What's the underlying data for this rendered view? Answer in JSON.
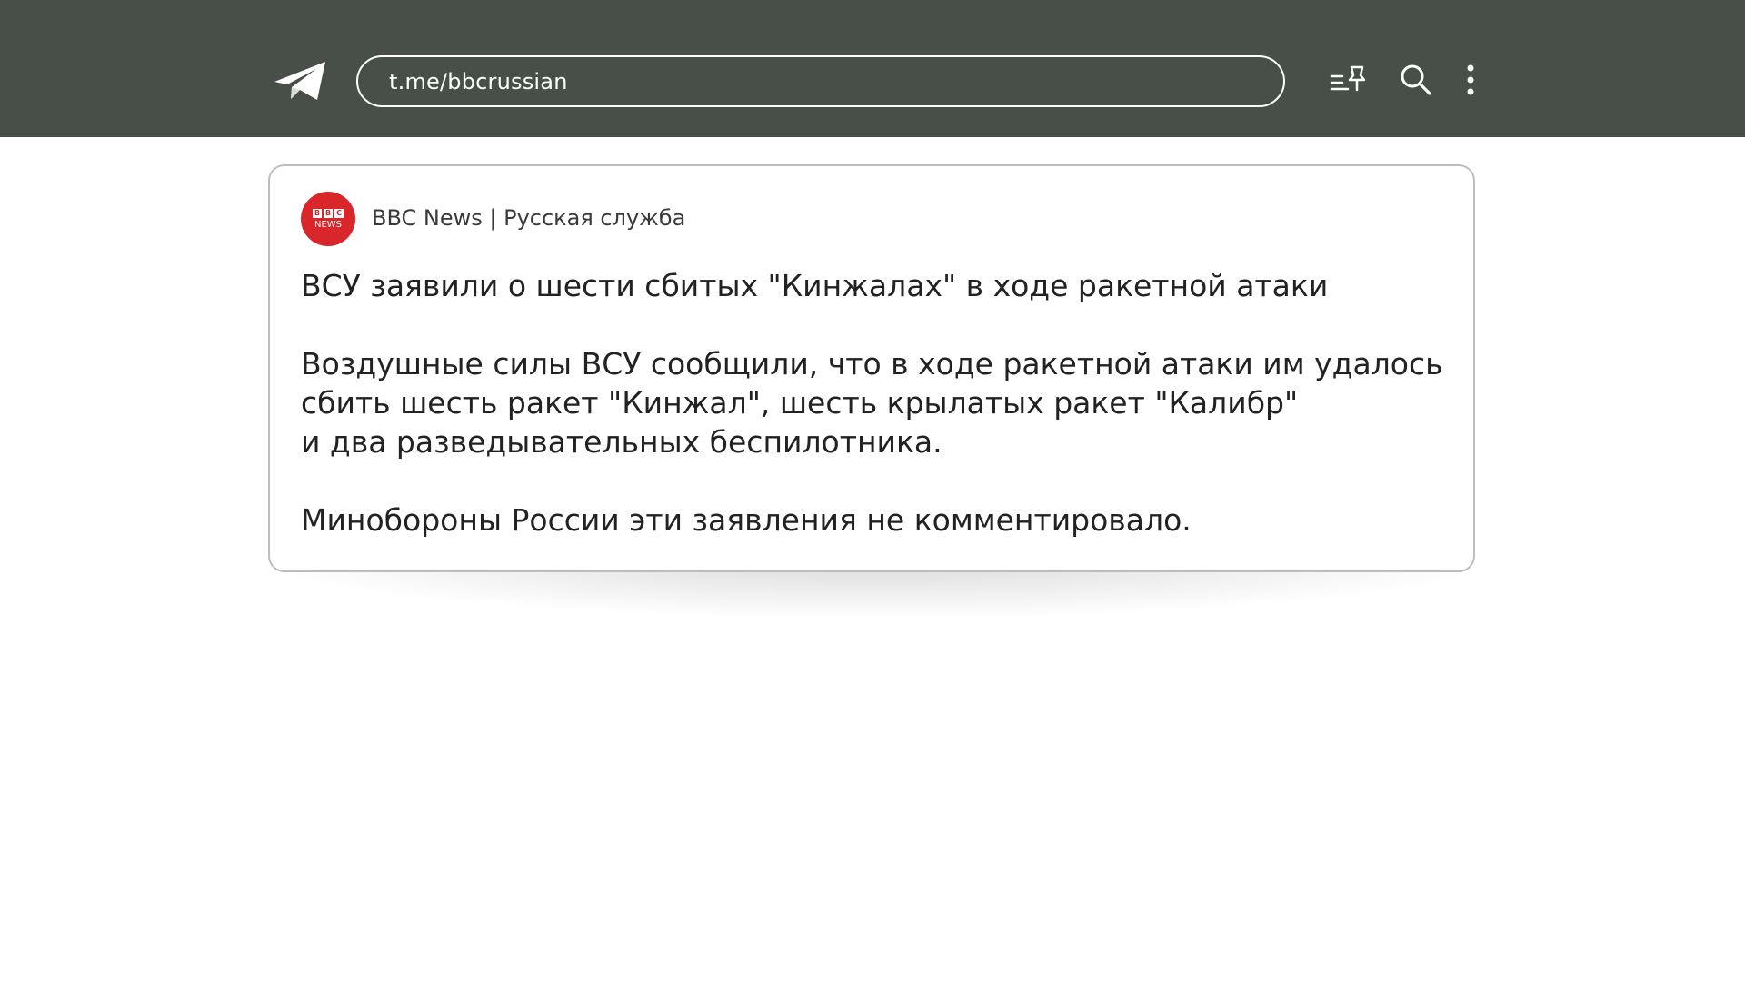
{
  "header": {
    "url": "t.me/bbcrussian",
    "icons": {
      "app": "telegram-icon",
      "pinned": "pinned-messages-icon",
      "search": "search-icon",
      "more": "more-vertical-icon"
    },
    "colors": {
      "bar": "#474f48",
      "foreground": "#ffffff"
    }
  },
  "post": {
    "avatar": {
      "blocks": [
        "B",
        "B",
        "C"
      ],
      "word": "NEWS",
      "color": "#d8262b"
    },
    "channel_name": "BBC News | Русская служба",
    "headline": "ВСУ заявили о шести сбитых \"Кинжалах\" в ходе ракетной атаки",
    "paragraph1_lines": [
      "Воздушные силы ВСУ сообщили, что в ходе ракетной атаки им удалось",
      "сбить шесть ракет \"Кинжал\", шесть крылатых ракет \"Калибр\"",
      "и два разведывательных беспилотника."
    ],
    "paragraph2": "Минобороны России эти заявления не комментировало."
  }
}
